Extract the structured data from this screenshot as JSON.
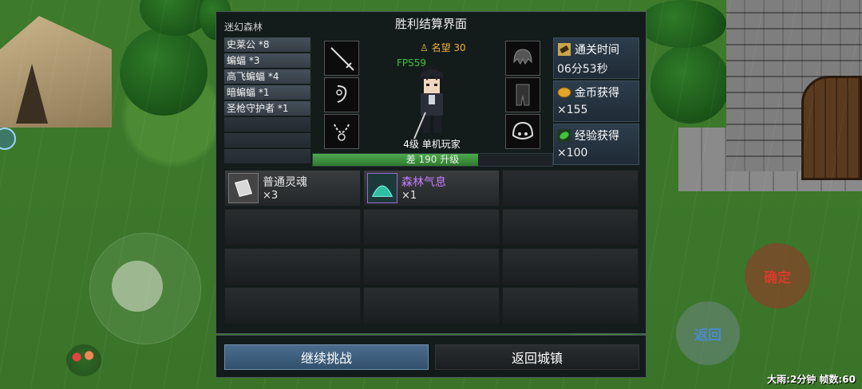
{
  "dialog": {
    "stage_name": "迷幻森林",
    "title": "胜利结算界面"
  },
  "kills": [
    "史莱公 *8",
    "蝙蝠 *3",
    "高飞蝙蝠 *4",
    "暗蝙蝠 *1",
    "圣枪守护者 *1"
  ],
  "player": {
    "fame": "名望 30",
    "fps": "FPS59",
    "label": "4级 单机玩家",
    "exp_text": "差 190 升级",
    "exp_fraction": 0.69
  },
  "equipment_left": [
    "sword-icon",
    "earring-icon",
    "necklace-icon"
  ],
  "equipment_right": [
    "hair-icon",
    "armor-icon",
    "helmet-icon"
  ],
  "info": {
    "clear_time_label": "通关时间",
    "clear_time_value": "06分53秒",
    "gold_label": "金币获得",
    "gold_value": "×155",
    "exp_label": "经验获得",
    "exp_value": "×100"
  },
  "rewards": [
    {
      "name": "普通灵魂",
      "count": "×3",
      "color": "#ffffff",
      "icon": "soul-icon"
    },
    {
      "name": "森林气息",
      "count": "×1",
      "color": "#c77dff",
      "icon": "forest-breath-icon"
    }
  ],
  "buttons": {
    "continue": "继续挑战",
    "return": "返回城镇"
  },
  "hud": {
    "confirm": "确定",
    "back": "返回",
    "status": "大雨:2分钟 帧数:60"
  }
}
